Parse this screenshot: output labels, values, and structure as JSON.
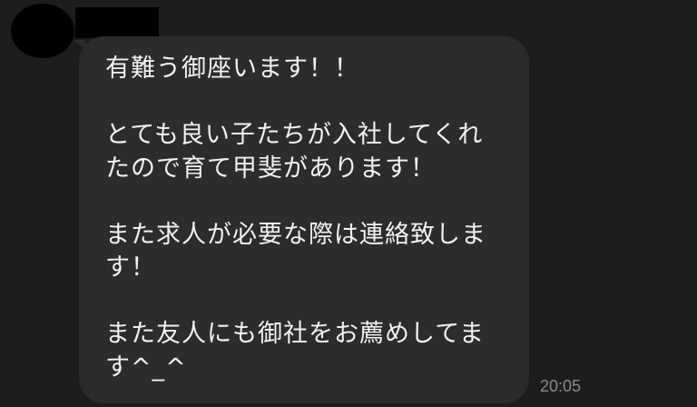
{
  "chat": {
    "sender_name": "",
    "message": {
      "text": "有難う御座います！！\n\nとても良い子たちが入社してくれ\nたので育て甲斐があります！\n\nまた求人が必要な際は連絡致しま\nす！\n\nまた友人にも御社をお薦めしてま\nす^_^",
      "time": "20:05"
    }
  },
  "colors": {
    "background": "#1d1d1d",
    "bubble": "#2c2c2c",
    "text": "#f2f2f2",
    "timestamp": "#8a8a8a"
  }
}
